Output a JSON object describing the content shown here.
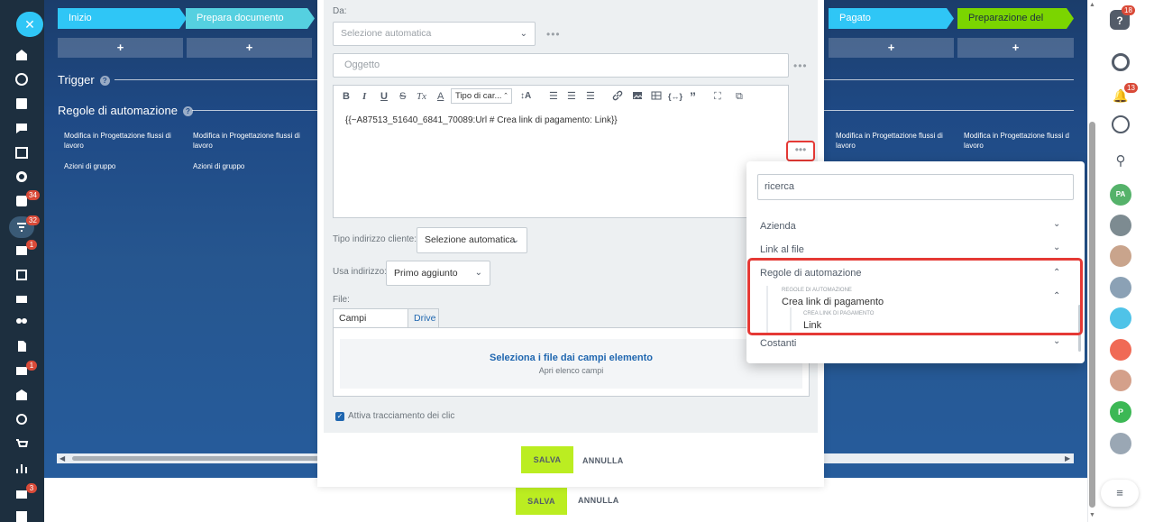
{
  "nav": {
    "close_icon": "close-icon",
    "badges": {
      "tasks": "34",
      "crm": "32",
      "contacts": "1",
      "mail": "1",
      "shop": "3"
    }
  },
  "pipeline": {
    "stages": [
      {
        "label": "Inizio",
        "color": "#2fc6f6"
      },
      {
        "label": "Prepara documento",
        "color": "#55d0e0"
      },
      {
        "label": "Pagato",
        "color": "#2fc6f6"
      },
      {
        "label": "Preparazione del proge...",
        "color": "#7bd500"
      }
    ],
    "add_label": "+",
    "trigger_label": "Trigger",
    "rules_label": "Regole di automazione",
    "help_glyph": "?",
    "rule_texts": [
      "Modifica in Progettazione flussi di lavoro",
      "Modifica in Progettazione flussi di lavoro",
      "Modifica in Progettazione flussi di lavoro",
      "Modifica in Progettazione flussi d lavoro"
    ],
    "group_actions": [
      "Azioni di gruppo",
      "Azioni di gruppo"
    ]
  },
  "dialog": {
    "from_label": "Da:",
    "from_select": "Selezione automatica",
    "subject_placeholder": "Oggetto",
    "more_dots": "•••",
    "toolbar": {
      "bold": "B",
      "italic": "I",
      "underline": "U",
      "strike": "S",
      "clear": "Tx",
      "color": "A",
      "font_type": "Tipo di car...",
      "font_size": "↕A",
      "numbered": "☰",
      "bulleted": "☰",
      "align": "☰",
      "link": "link-icon",
      "image": "image-icon",
      "table": "table-icon",
      "code": "{↔}",
      "quote": "”",
      "fullscreen": "⛶",
      "source": "⧉"
    },
    "body_text": "{{~A87513_51640_6841_70089:Url # Crea link di pagamento: Link}}",
    "client_address_label": "Tipo indirizzo cliente:",
    "client_address_value": "Selezione automatica",
    "use_address_label": "Usa indirizzo:",
    "use_address_value": "Primo aggiunto",
    "file_label": "File:",
    "tabs": [
      "Campi elemento",
      "Drive"
    ],
    "file_select_link": "Seleziona i file dai campi elemento",
    "file_select_sub": "Apri elenco campi",
    "tracking_label": "Attiva tracciamento dei clic",
    "tracking_checked": true,
    "save": "SALVA",
    "cancel": "ANNULLA"
  },
  "popup": {
    "search_placeholder": "ricerca",
    "items": [
      {
        "label": "Azienda",
        "expanded": false
      },
      {
        "label": "Link al file",
        "expanded": false
      },
      {
        "label": "Regole di automazione",
        "expanded": true
      },
      {
        "label": "Costanti",
        "expanded": false
      }
    ],
    "sub_caption": "REGOLE DI AUTOMAZIONE",
    "sub_item": "Crea link di pagamento",
    "sub_sub_caption": "CREA LINK DI PAGAMENTO",
    "sub_sub_item": "Link"
  },
  "footer": {
    "save": "SALVA",
    "cancel": "ANNULLA"
  },
  "rightbar": {
    "help_badge": "18",
    "notif_badge": "13",
    "avatars": [
      "PA",
      "",
      "",
      "",
      "",
      "",
      "",
      "P",
      ""
    ]
  }
}
